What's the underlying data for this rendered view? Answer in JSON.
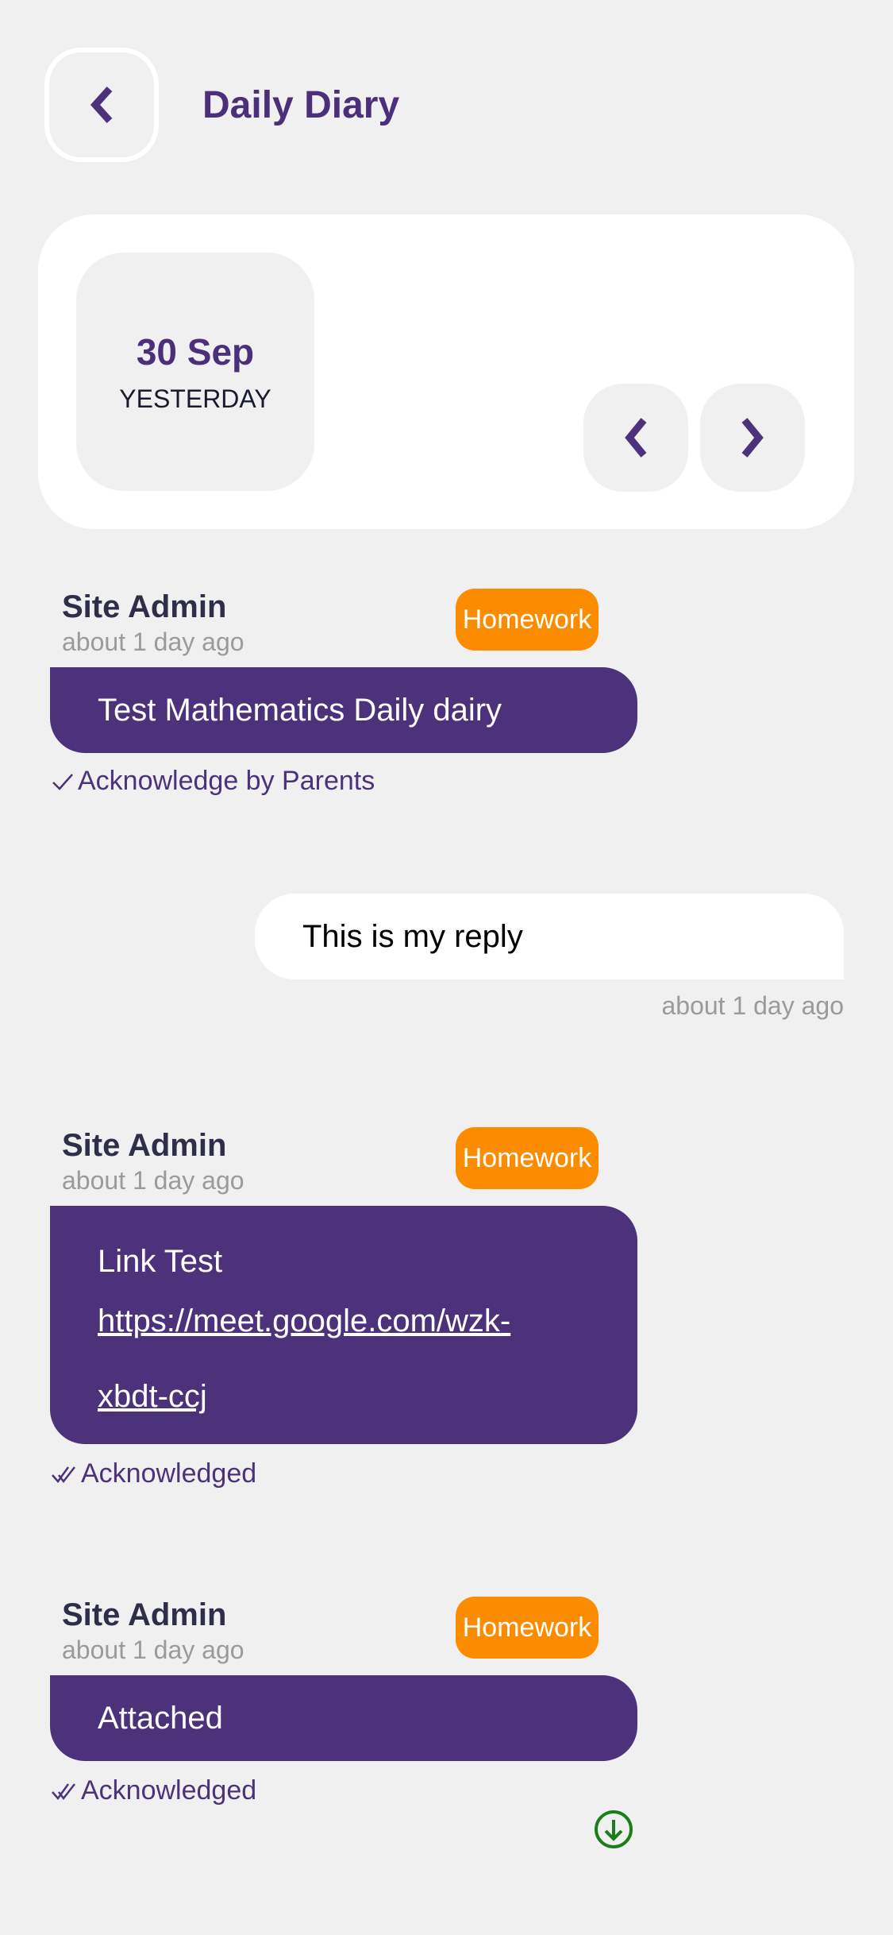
{
  "header": {
    "title": "Daily Diary",
    "back_icon": "chevron-left-icon"
  },
  "date_card": {
    "date": "30 Sep",
    "relative": "YESTERDAY",
    "prev_icon": "chevron-left-icon",
    "next_icon": "chevron-right-icon"
  },
  "colors": {
    "primary": "#4c317b",
    "badge": "#fb8c00",
    "background": "#f0f0f0",
    "download": "#1a7f1a"
  },
  "messages": [
    {
      "sender": "Site Admin",
      "time": "about 1 day ago",
      "badge": "Homework",
      "text": "Test Mathematics Daily dairy",
      "ack_icon": "check-icon",
      "ack": "Acknowledge by Parents"
    },
    {
      "sender": "Site Admin",
      "time": "about 1 day ago",
      "badge": "Homework",
      "text": "Link Test",
      "link_line1": "https://meet.google.com/wzk-",
      "link_line2": "xbdt-ccj",
      "ack_icon": "double-check-icon",
      "ack": "Acknowledged"
    },
    {
      "sender": "Site Admin",
      "time": "about 1 day ago",
      "badge": "Homework",
      "text": "Attached",
      "ack_icon": "double-check-icon",
      "ack": "Acknowledged",
      "attachment_icon": "download-icon"
    }
  ],
  "reply": {
    "text": "This is my reply",
    "time": "about 1 day ago"
  }
}
